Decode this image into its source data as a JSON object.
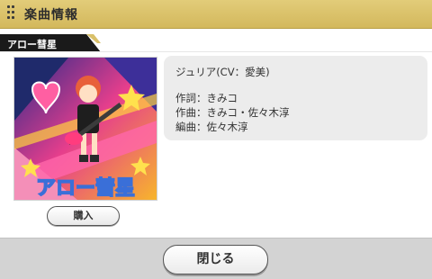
{
  "header": {
    "title": "楽曲情報",
    "grip_icon": "drag-grip-icon"
  },
  "song": {
    "title_tab": "アロー彗星",
    "jacket_title": "アロー彗星"
  },
  "info": {
    "singer": "ジュリア(CV：愛美)",
    "lyrics": "作詞：きみコ",
    "composer": "作曲：きみコ・佐々木淳",
    "arranger": "編曲：佐々木淳"
  },
  "actions": {
    "buy_label": "購入",
    "close_label": "閉じる"
  },
  "colors": {
    "header_gold": "#d9c06a",
    "tab_black": "#1a1a1a",
    "info_box_bg": "#ececec",
    "footer_gray": "#d3d3d3"
  }
}
